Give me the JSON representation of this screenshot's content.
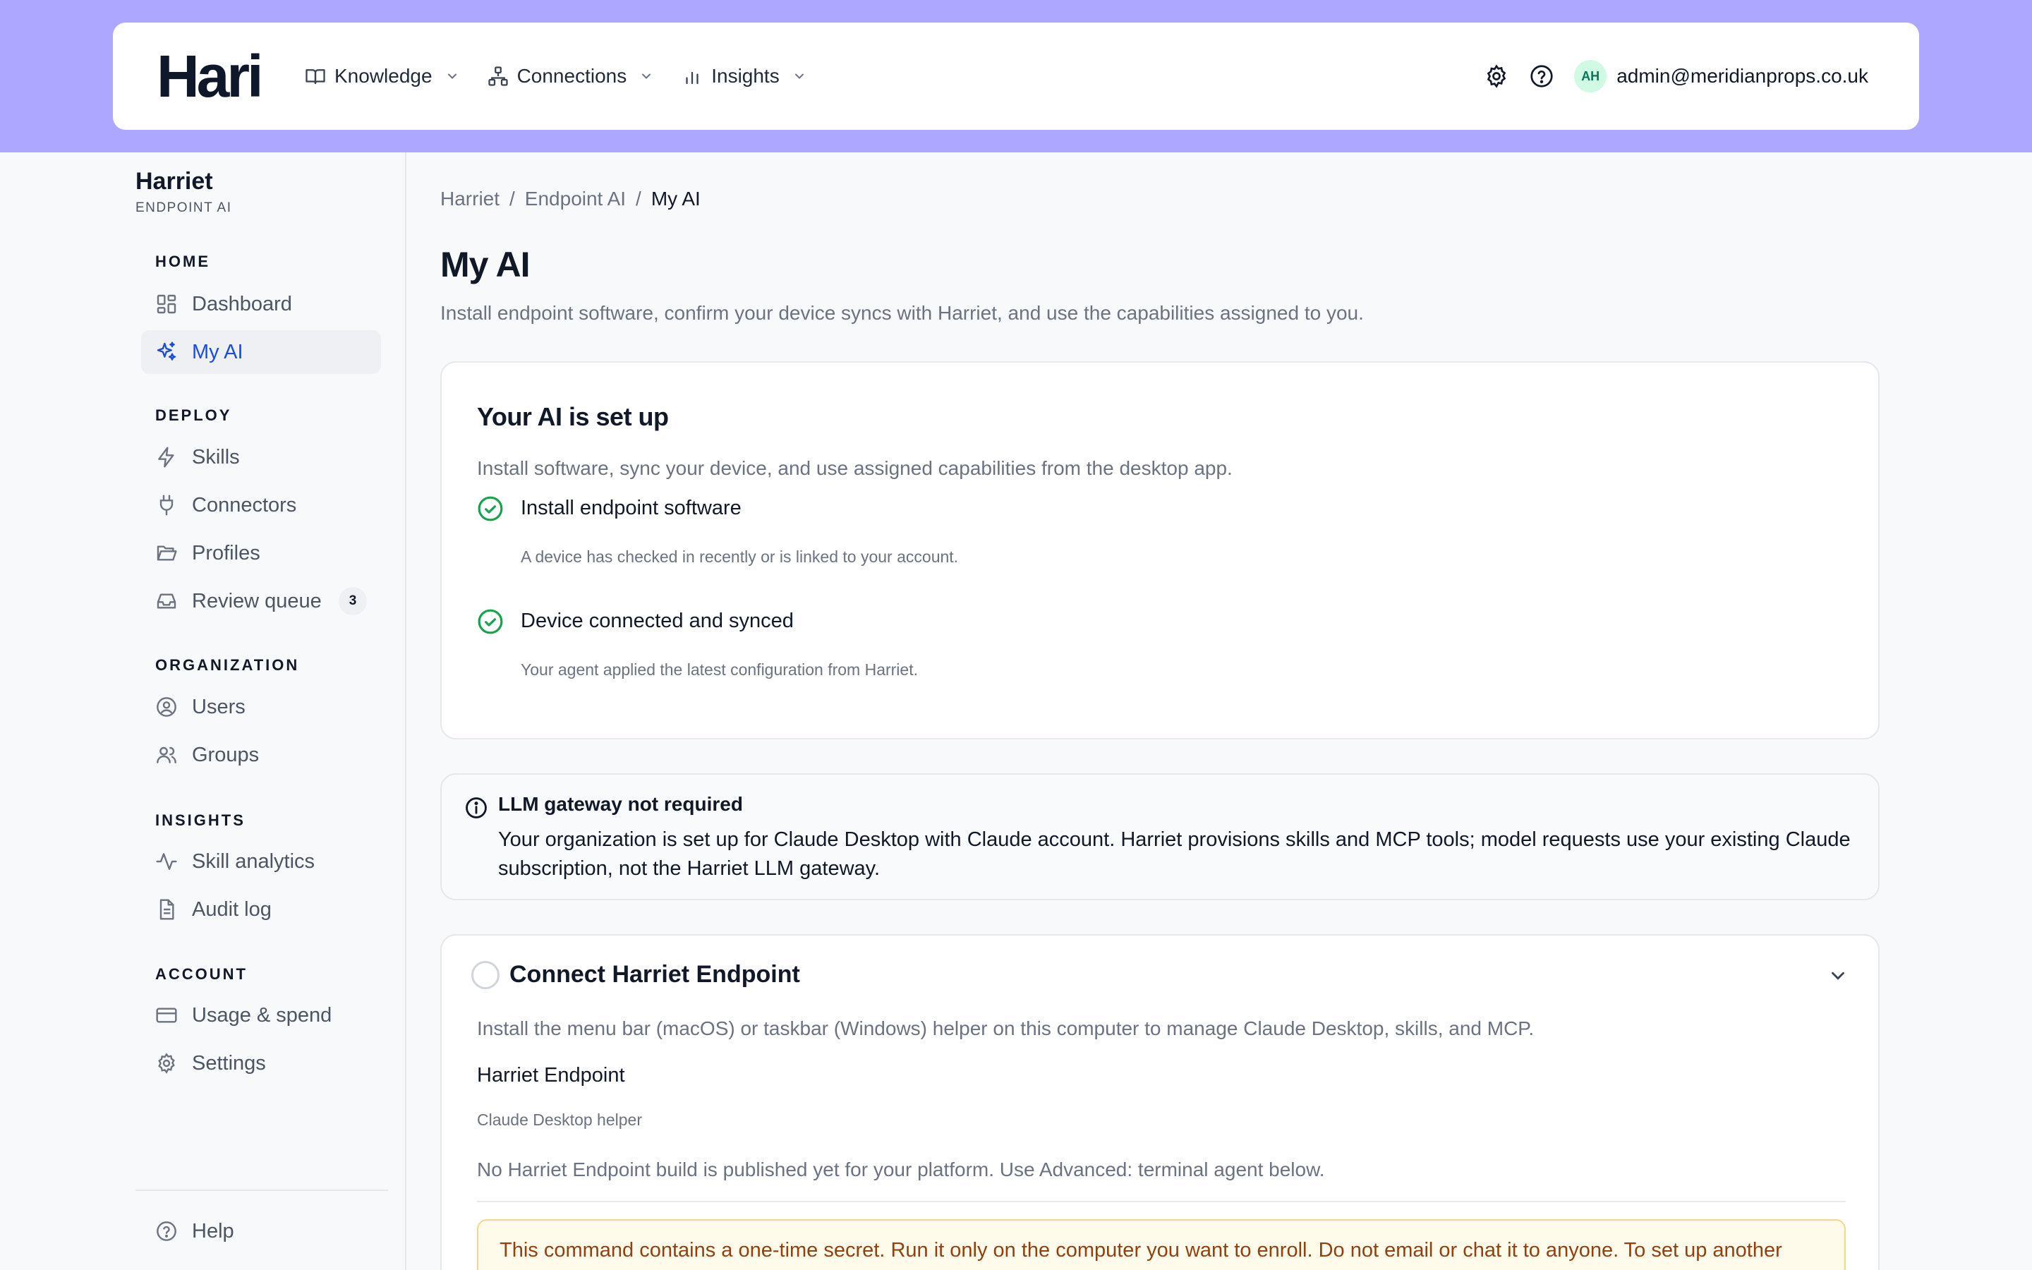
{
  "brand": {
    "logo": "Hari"
  },
  "topnav": {
    "items": [
      {
        "label": "Knowledge",
        "icon": "book-icon"
      },
      {
        "label": "Connections",
        "icon": "network-icon"
      },
      {
        "label": "Insights",
        "icon": "bar-chart-icon"
      }
    ],
    "avatar_initials": "AH",
    "user_email": "admin@meridianprops.co.uk"
  },
  "sidebar": {
    "org_name": "Harriet",
    "org_sub": "ENDPOINT AI",
    "sections": {
      "home": "HOME",
      "deploy": "DEPLOY",
      "organization": "ORGANIZATION",
      "insights": "INSIGHTS",
      "account": "ACCOUNT"
    },
    "items": {
      "dashboard": "Dashboard",
      "my_ai": "My AI",
      "skills": "Skills",
      "connectors": "Connectors",
      "profiles": "Profiles",
      "review_queue": "Review queue",
      "review_queue_count": "3",
      "users": "Users",
      "groups": "Groups",
      "skill_analytics": "Skill analytics",
      "audit_log": "Audit log",
      "usage_spend": "Usage & spend",
      "settings": "Settings",
      "help": "Help"
    }
  },
  "breadcrumb": {
    "c1": "Harriet",
    "c2": "Endpoint AI",
    "c3": "My AI",
    "sep": "/"
  },
  "page": {
    "title": "My AI",
    "description": "Install endpoint software, confirm your device syncs with Harriet, and use the capabilities assigned to you."
  },
  "setup_card": {
    "title": "Your AI is set up",
    "intro": "Install software, sync your device, and use assigned capabilities from the desktop app.",
    "steps": [
      {
        "title": "Install endpoint software",
        "sub": "A device has checked in recently or is linked to your account."
      },
      {
        "title": "Device connected and synced",
        "sub": "Your agent applied the latest configuration from Harriet."
      }
    ]
  },
  "gateway_card": {
    "title": "LLM gateway not required",
    "body": "Your organization is set up for Claude Desktop with Claude account. Harriet provisions skills and MCP tools; model requests use your existing Claude subscription, not the Harriet LLM gateway."
  },
  "connect_card": {
    "title": "Connect Harriet Endpoint",
    "description": "Install the menu bar (macOS) or taskbar (Windows) helper on this computer to manage Claude Desktop, skills, and MCP.",
    "product_name": "Harriet Endpoint",
    "product_sub": "Claude Desktop helper",
    "no_build": "No Harriet Endpoint build is published yet for your platform. Use Advanced: terminal agent below.",
    "warning": "This command contains a one-time secret. Run it only on the computer you want to enroll. Do not email or chat it to anyone. To set up another"
  },
  "colors": {
    "band": "#aea7ff",
    "accent": "#1d4ed8",
    "success": "#16a34a",
    "warning_bg": "#fffbeb",
    "warning_text": "#92400e"
  }
}
